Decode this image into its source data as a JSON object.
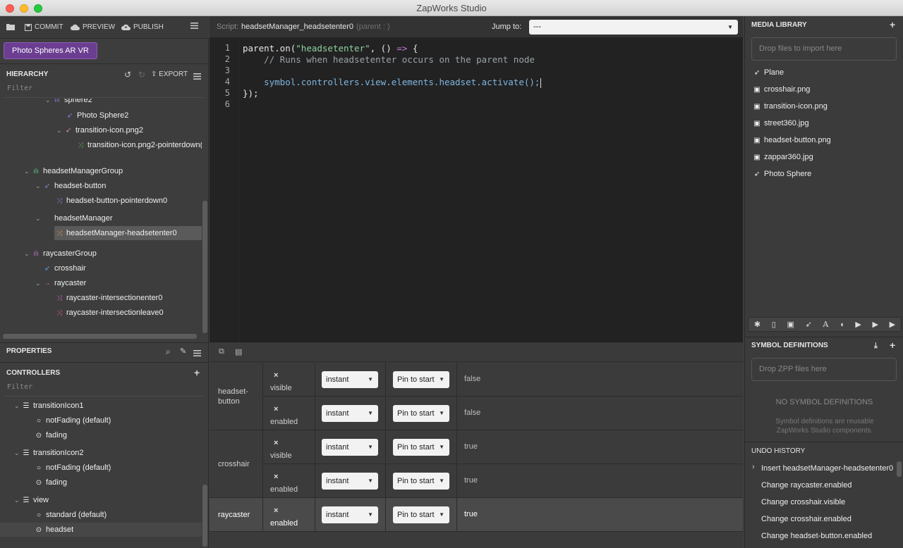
{
  "window": {
    "title": "ZapWorks Studio"
  },
  "toolbar": {
    "commit": "COMMIT",
    "preview": "PREVIEW",
    "publish": "PUBLISH"
  },
  "project": {
    "name": "Photo Spheres AR VR"
  },
  "hierarchy": {
    "title": "HIERARCHY",
    "export": "EXPORT",
    "filter_placeholder": "Filter",
    "items": [
      {
        "label": "sphere2",
        "icon": "group-icon",
        "color": "#8a72c8"
      },
      {
        "label": "Photo Sphere2",
        "icon": "rocket-icon",
        "color": "#9a7fe0"
      },
      {
        "label": "transition-icon.png2",
        "icon": "rocket-icon",
        "color": "#d98a8a"
      },
      {
        "label": "transition-icon.png2-pointerdown(",
        "icon": "event-icon",
        "color": "#5aa55a"
      },
      {
        "label": "headsetManagerGroup",
        "icon": "group-icon",
        "color": "#5abf8a"
      },
      {
        "label": "headset-button",
        "icon": "rocket-icon",
        "color": "#7a88d8"
      },
      {
        "label": "headset-button-pointerdown0",
        "icon": "event-icon",
        "color": "#7a88d8"
      },
      {
        "label": "headsetManager",
        "icon": "",
        "color": ""
      },
      {
        "label": "headsetManager-headsetenter0",
        "icon": "event-icon",
        "color": "#d98a4a"
      },
      {
        "label": "raycasterGroup",
        "icon": "group-icon",
        "color": "#b070c0"
      },
      {
        "label": "crosshair",
        "icon": "rocket-icon",
        "color": "#5aa0e0"
      },
      {
        "label": "raycaster",
        "icon": "arrow-icon",
        "color": "#e05a7a"
      },
      {
        "label": "raycaster-intersectionenter0",
        "icon": "event-icon",
        "color": "#d05ac0"
      },
      {
        "label": "raycaster-intersectionleave0",
        "icon": "event-icon",
        "color": "#d05a7a"
      }
    ]
  },
  "properties": {
    "title": "PROPERTIES"
  },
  "controllers": {
    "title": "CONTROLLERS",
    "filter_placeholder": "Filter",
    "groups": [
      {
        "label": "transitionIcon1",
        "states": [
          "notFading (default)",
          "fading"
        ]
      },
      {
        "label": "transitionIcon2",
        "states": [
          "notFading (default)",
          "fading"
        ]
      },
      {
        "label": "view",
        "states": [
          "standard (default)",
          "headset"
        ]
      }
    ]
  },
  "script": {
    "prefix": "Script:",
    "name": "headsetManager_headsetenter0",
    "parent": "(parent : )",
    "jump_label": "Jump to:",
    "jump_value": "---"
  },
  "code": {
    "lines": [
      "parent.on(\"headsetenter\", () => {",
      "    // Runs when headsetenter occurs on the parent node",
      "",
      "    symbol.controllers.view.elements.headset.activate();",
      "});",
      ""
    ]
  },
  "state_table": {
    "rows": [
      {
        "node": "headset-button",
        "prop": "visible",
        "transition": "instant",
        "pin": "Pin to start",
        "value": "false"
      },
      {
        "node": "",
        "prop": "enabled",
        "transition": "instant",
        "pin": "Pin to start",
        "value": "false"
      },
      {
        "node": "crosshair",
        "prop": "visible",
        "transition": "instant",
        "pin": "Pin to start",
        "value": "true"
      },
      {
        "node": "",
        "prop": "enabled",
        "transition": "instant",
        "pin": "Pin to start",
        "value": "true"
      },
      {
        "node": "raycaster",
        "prop": "enabled",
        "transition": "instant",
        "pin": "Pin to start",
        "value": "true"
      }
    ],
    "remove_glyph": "×"
  },
  "media_library": {
    "title": "MEDIA LIBRARY",
    "dropzone": "Drop files to import here",
    "items": [
      {
        "label": "Plane",
        "icon": "rocket-icon"
      },
      {
        "label": "crosshair.png",
        "icon": "image-icon"
      },
      {
        "label": "transition-icon.png",
        "icon": "image-icon"
      },
      {
        "label": "street360.jpg",
        "icon": "image-icon"
      },
      {
        "label": "headset-button.png",
        "icon": "image-icon"
      },
      {
        "label": "zappar360.jpg",
        "icon": "image-icon"
      },
      {
        "label": "Photo Sphere",
        "icon": "rocket-icon"
      }
    ]
  },
  "symbol_definitions": {
    "title": "SYMBOL DEFINITIONS",
    "dropzone": "Drop ZPP files here",
    "empty_title": "NO SYMBOL DEFINITIONS",
    "empty_desc": "Symbol definitions are reusable ZapWorks Studio components."
  },
  "undo_history": {
    "title": "UNDO HISTORY",
    "items": [
      "Insert headsetManager-headsetenter0",
      "Change raycaster.enabled",
      "Change crosshair.visible",
      "Change crosshair.enabled",
      "Change headset-button.enabled"
    ]
  }
}
